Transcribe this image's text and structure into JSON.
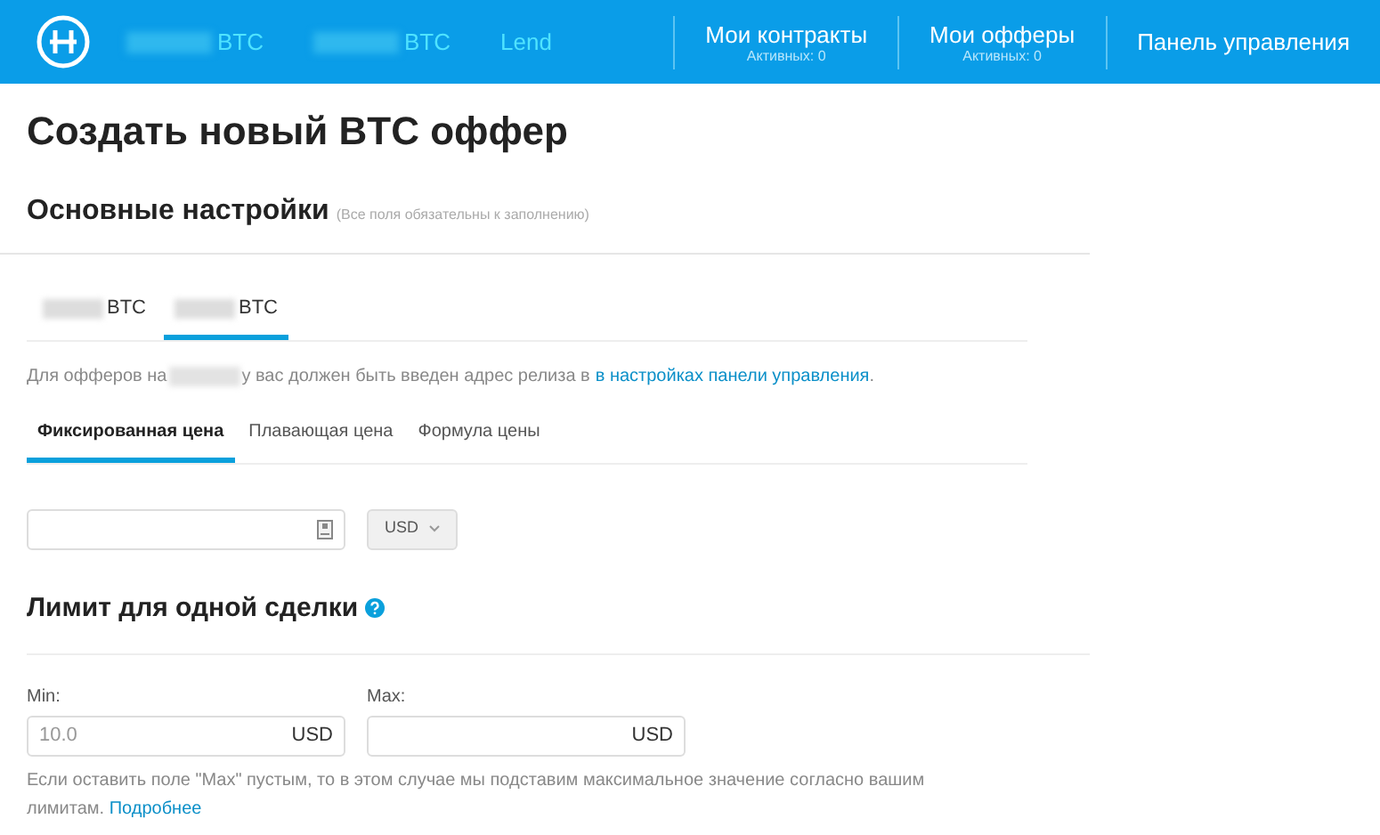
{
  "header": {
    "nav_left": [
      {
        "label": "BTC",
        "redacted_prefix": true
      },
      {
        "label": "BTC",
        "redacted_prefix": true
      },
      {
        "label": "Lend",
        "redacted_prefix": false
      }
    ],
    "nav_right": [
      {
        "label": "Мои контракты",
        "sub": "Активных: 0"
      },
      {
        "label": "Мои офферы",
        "sub": "Активных: 0"
      },
      {
        "label": "Панель управления"
      }
    ]
  },
  "page_title": "Создать новый BTC оффер",
  "section": {
    "title": "Основные настройки",
    "note": "(Все поля обязательны к заполнению)"
  },
  "trade_tabs": [
    {
      "label": "BTC",
      "redacted_prefix": true,
      "selected": false
    },
    {
      "label": "BTC",
      "redacted_prefix": true,
      "selected": true
    }
  ],
  "notice": {
    "before": "Для офферов на",
    "after": "у вас должен быть введен адрес релиза в",
    "link": "в настройках панели управления",
    "end": "."
  },
  "price_tabs": [
    {
      "label": "Фиксированная цена",
      "selected": true
    },
    {
      "label": "Плавающая цена",
      "selected": false
    },
    {
      "label": "Формула цены",
      "selected": false
    }
  ],
  "currency_select": {
    "value": "USD"
  },
  "limit": {
    "title": "Лимит для одной сделки",
    "min": {
      "label": "Min:",
      "value": "10.0",
      "unit": "USD"
    },
    "max": {
      "label": "Max:",
      "unit": "USD"
    },
    "hint": "Если оставить поле \"Max\" пустым, то в этом случае мы подставим максимальное значение согласно вашим лимитам.",
    "hint_link": "Подробнее"
  }
}
